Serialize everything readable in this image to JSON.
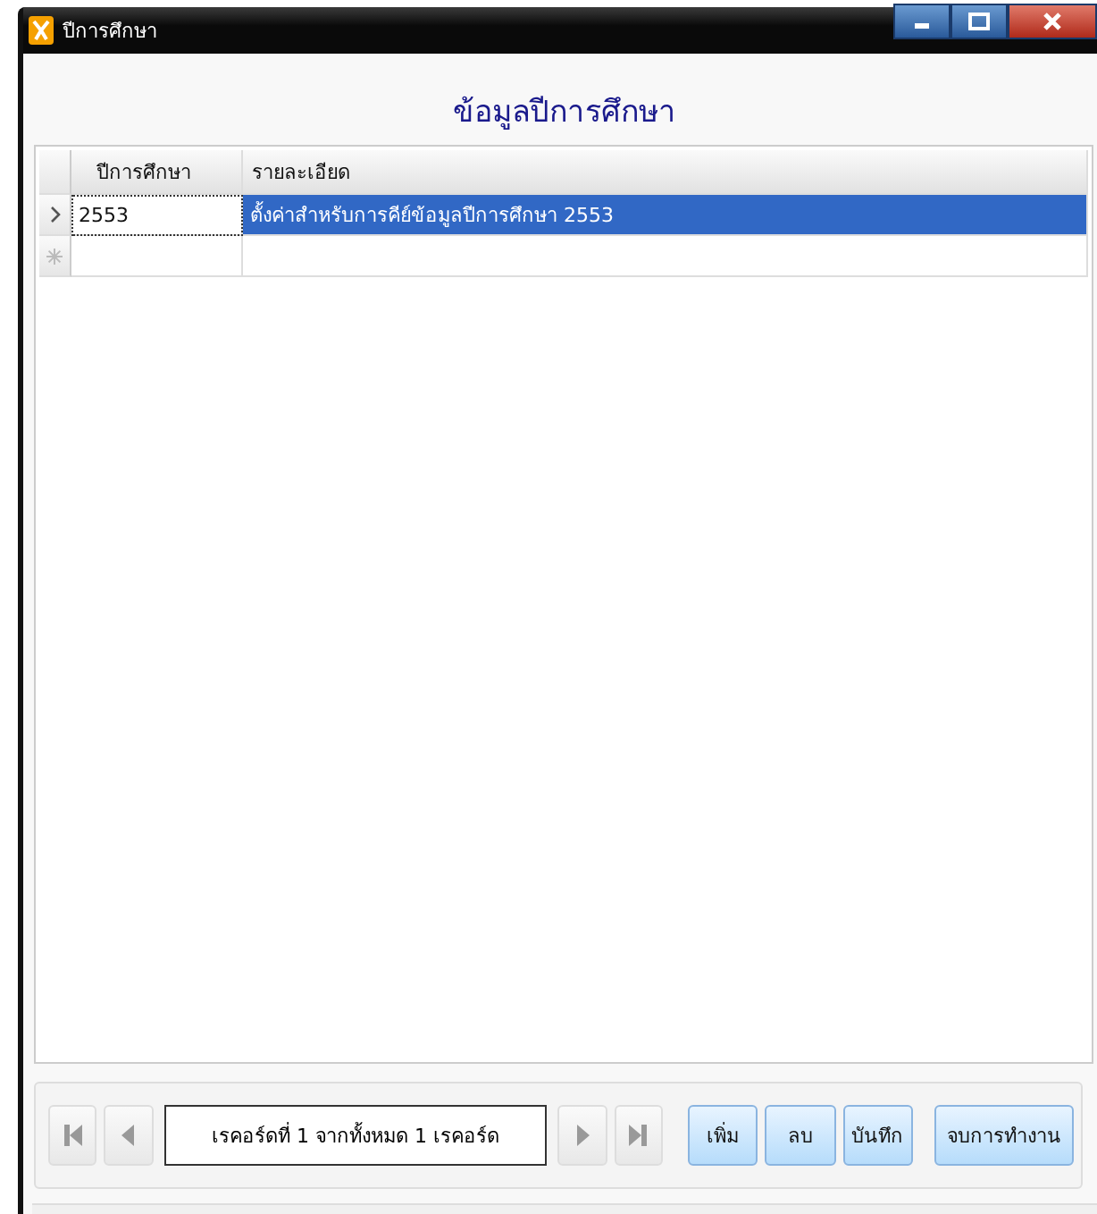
{
  "window": {
    "title": "ปีการศึกษา"
  },
  "heading": "ข้อมูลปีการศึกษา",
  "table": {
    "columns": [
      "ปีการศึกษา",
      "รายละเอียด"
    ],
    "rows": [
      {
        "kind": "data",
        "selected": true,
        "cells": [
          "2553",
          "ตั้งค่าสำหรับการคีย์ข้อมูลปีการศึกษา 2553"
        ]
      },
      {
        "kind": "new",
        "selected": false,
        "cells": [
          "",
          ""
        ]
      }
    ]
  },
  "navigator": {
    "first": {
      "disabled": true
    },
    "previous": {
      "disabled": true
    },
    "position": "เรคอร์ดที่ 1 จากทั้งหมด 1 เรคอร์ด",
    "next": {
      "disabled": true
    },
    "last": {
      "disabled": true
    }
  },
  "buttons": [
    "เพิ่ม",
    "ลบ",
    "บันทึก",
    "จบการทำงาน"
  ]
}
